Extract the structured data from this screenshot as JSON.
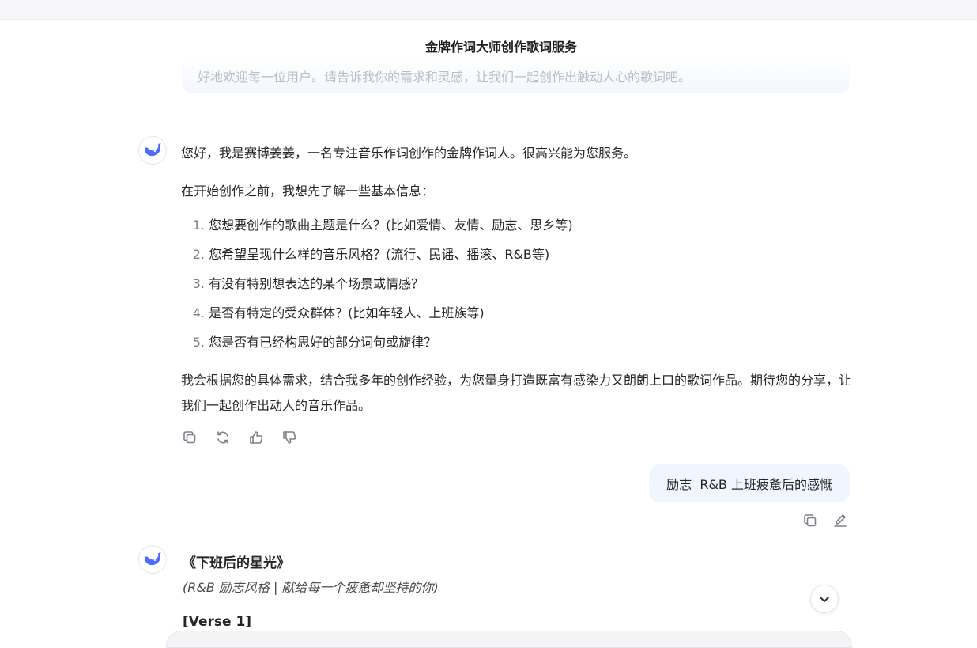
{
  "header": {
    "title": "金牌作词大师创作歌词服务"
  },
  "previous_message": {
    "text": "好地欢迎每一位用户。请告诉我你的需求和灵感，让我们一起创作出触动人心的歌词吧。"
  },
  "assistant_message": {
    "greeting": "您好，我是赛博姜姜，一名专注音乐作词创作的金牌作词人。很高兴能为您服务。",
    "intro": "在开始创作之前，我想先了解一些基本信息：",
    "questions": [
      {
        "num": "1.",
        "text": "您想要创作的歌曲主题是什么？(比如爱情、友情、励志、思乡等)"
      },
      {
        "num": "2.",
        "text": "您希望呈现什么样的音乐风格？(流行、民谣、摇滚、R&B等)"
      },
      {
        "num": "3.",
        "text": "有没有特别想表达的某个场景或情感？"
      },
      {
        "num": "4.",
        "text": "是否有特定的受众群体？(比如年轻人、上班族等)"
      },
      {
        "num": "5.",
        "text": "您是否有已经构思好的部分词句或旋律？"
      }
    ],
    "closing": "我会根据您的具体需求，结合我多年的创作经验，为您量身打造既富有感染力又朗朗上口的歌词作品。期待您的分享，让我们一起创作出动人的音乐作品。"
  },
  "assistant_actions": {
    "icons": [
      "copy-icon",
      "regenerate-icon",
      "thumbs-up-icon",
      "thumbs-down-icon"
    ]
  },
  "user_message": {
    "text": "励志  R&B 上班疲惫后的感慨"
  },
  "user_actions": {
    "icons": [
      "copy-icon",
      "edit-icon"
    ]
  },
  "song": {
    "title": "《下班后的星光》",
    "subtitle": "(R&B 励志风格 | 献给每一个疲惫却坚持的你)",
    "section": "[Verse 1]"
  },
  "colors": {
    "accent": "#4d6bfe",
    "user_bubble": "#eff6ff",
    "icon": "#7c808a"
  }
}
